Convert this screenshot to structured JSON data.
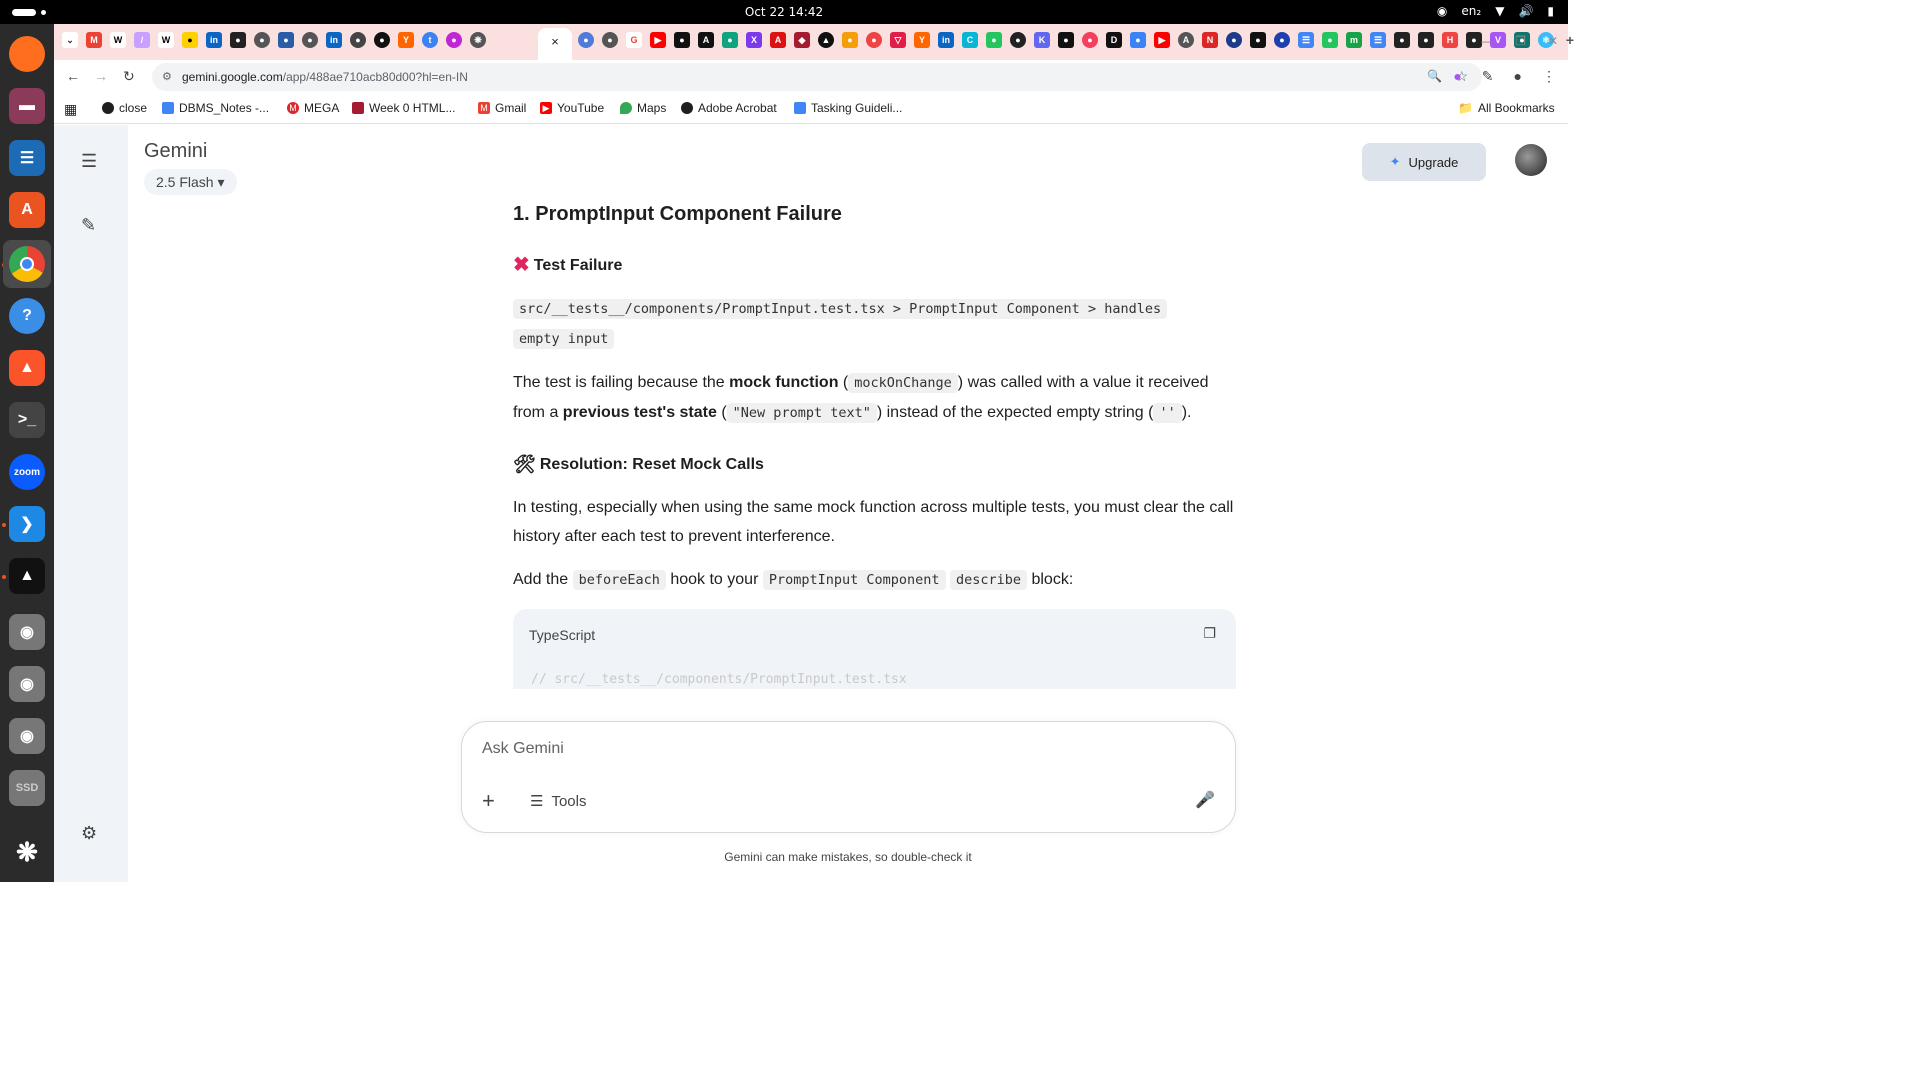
{
  "system": {
    "clock": "Oct 22  14:42",
    "input_lang": "en₂"
  },
  "browser": {
    "url_host": "gemini.google.com",
    "url_path": "/app/488ae710acb80d00?hl=en-IN",
    "active_tab_close": "×",
    "new_tab": "+"
  },
  "bookmarks": [
    {
      "label": "close",
      "color": "#1f1f1f"
    },
    {
      "label": "DBMS_Notes -...",
      "color": "#4285f4"
    },
    {
      "label": "MEGA",
      "color": "#d9272e"
    },
    {
      "label": "Week 0 HTML...",
      "color": "#a51c30"
    },
    {
      "label": "Gmail",
      "color": "#ea4335"
    },
    {
      "label": "YouTube",
      "color": "#ff0000"
    },
    {
      "label": "Maps",
      "color": "#34a853"
    },
    {
      "label": "Adobe Acrobat",
      "color": "#1f1f1f"
    },
    {
      "label": "Tasking Guideli...",
      "color": "#4285f4"
    }
  ],
  "all_bookmarks": "All Bookmarks",
  "app": {
    "brand": "Gemini",
    "model": "2.5 Flash",
    "upgrade": "Upgrade"
  },
  "response": {
    "heading": "1. PromptInput Component Failure",
    "failure_title": "Test Failure",
    "failure_path_line1": "src/__tests__/components/PromptInput.test.tsx > PromptInput Component > handles",
    "failure_path_line2": "empty input",
    "p1_a": "The test is failing because the ",
    "p1_b": "mock function",
    "p1_c": " (",
    "p1_code1": "mockOnChange",
    "p1_d": ") was called with a value it received from a ",
    "p1_e": "previous test's state",
    "p1_f": " (",
    "p1_code2": "\"New prompt text\"",
    "p1_g": ") instead of the expected empty string (",
    "p1_code3": "''",
    "p1_h": ").",
    "resolution_title": "Resolution: Reset Mock Calls",
    "p2": "In testing, especially when using the same mock function across multiple tests, you must clear the call history after each test to prevent interference.",
    "p3_a": "Add the ",
    "p3_code1": "beforeEach",
    "p3_b": " hook to your ",
    "p3_code2": "PromptInput Component",
    "p3_c": " ",
    "p3_code3": "describe",
    "p3_d": " block:",
    "code_lang": "TypeScript",
    "code_first_line": "// src/__tests__/components/PromptInput.test.tsx"
  },
  "composer": {
    "placeholder": "Ask Gemini",
    "tools": "Tools"
  },
  "disclaimer": "Gemini can make mistakes, so double-check it"
}
